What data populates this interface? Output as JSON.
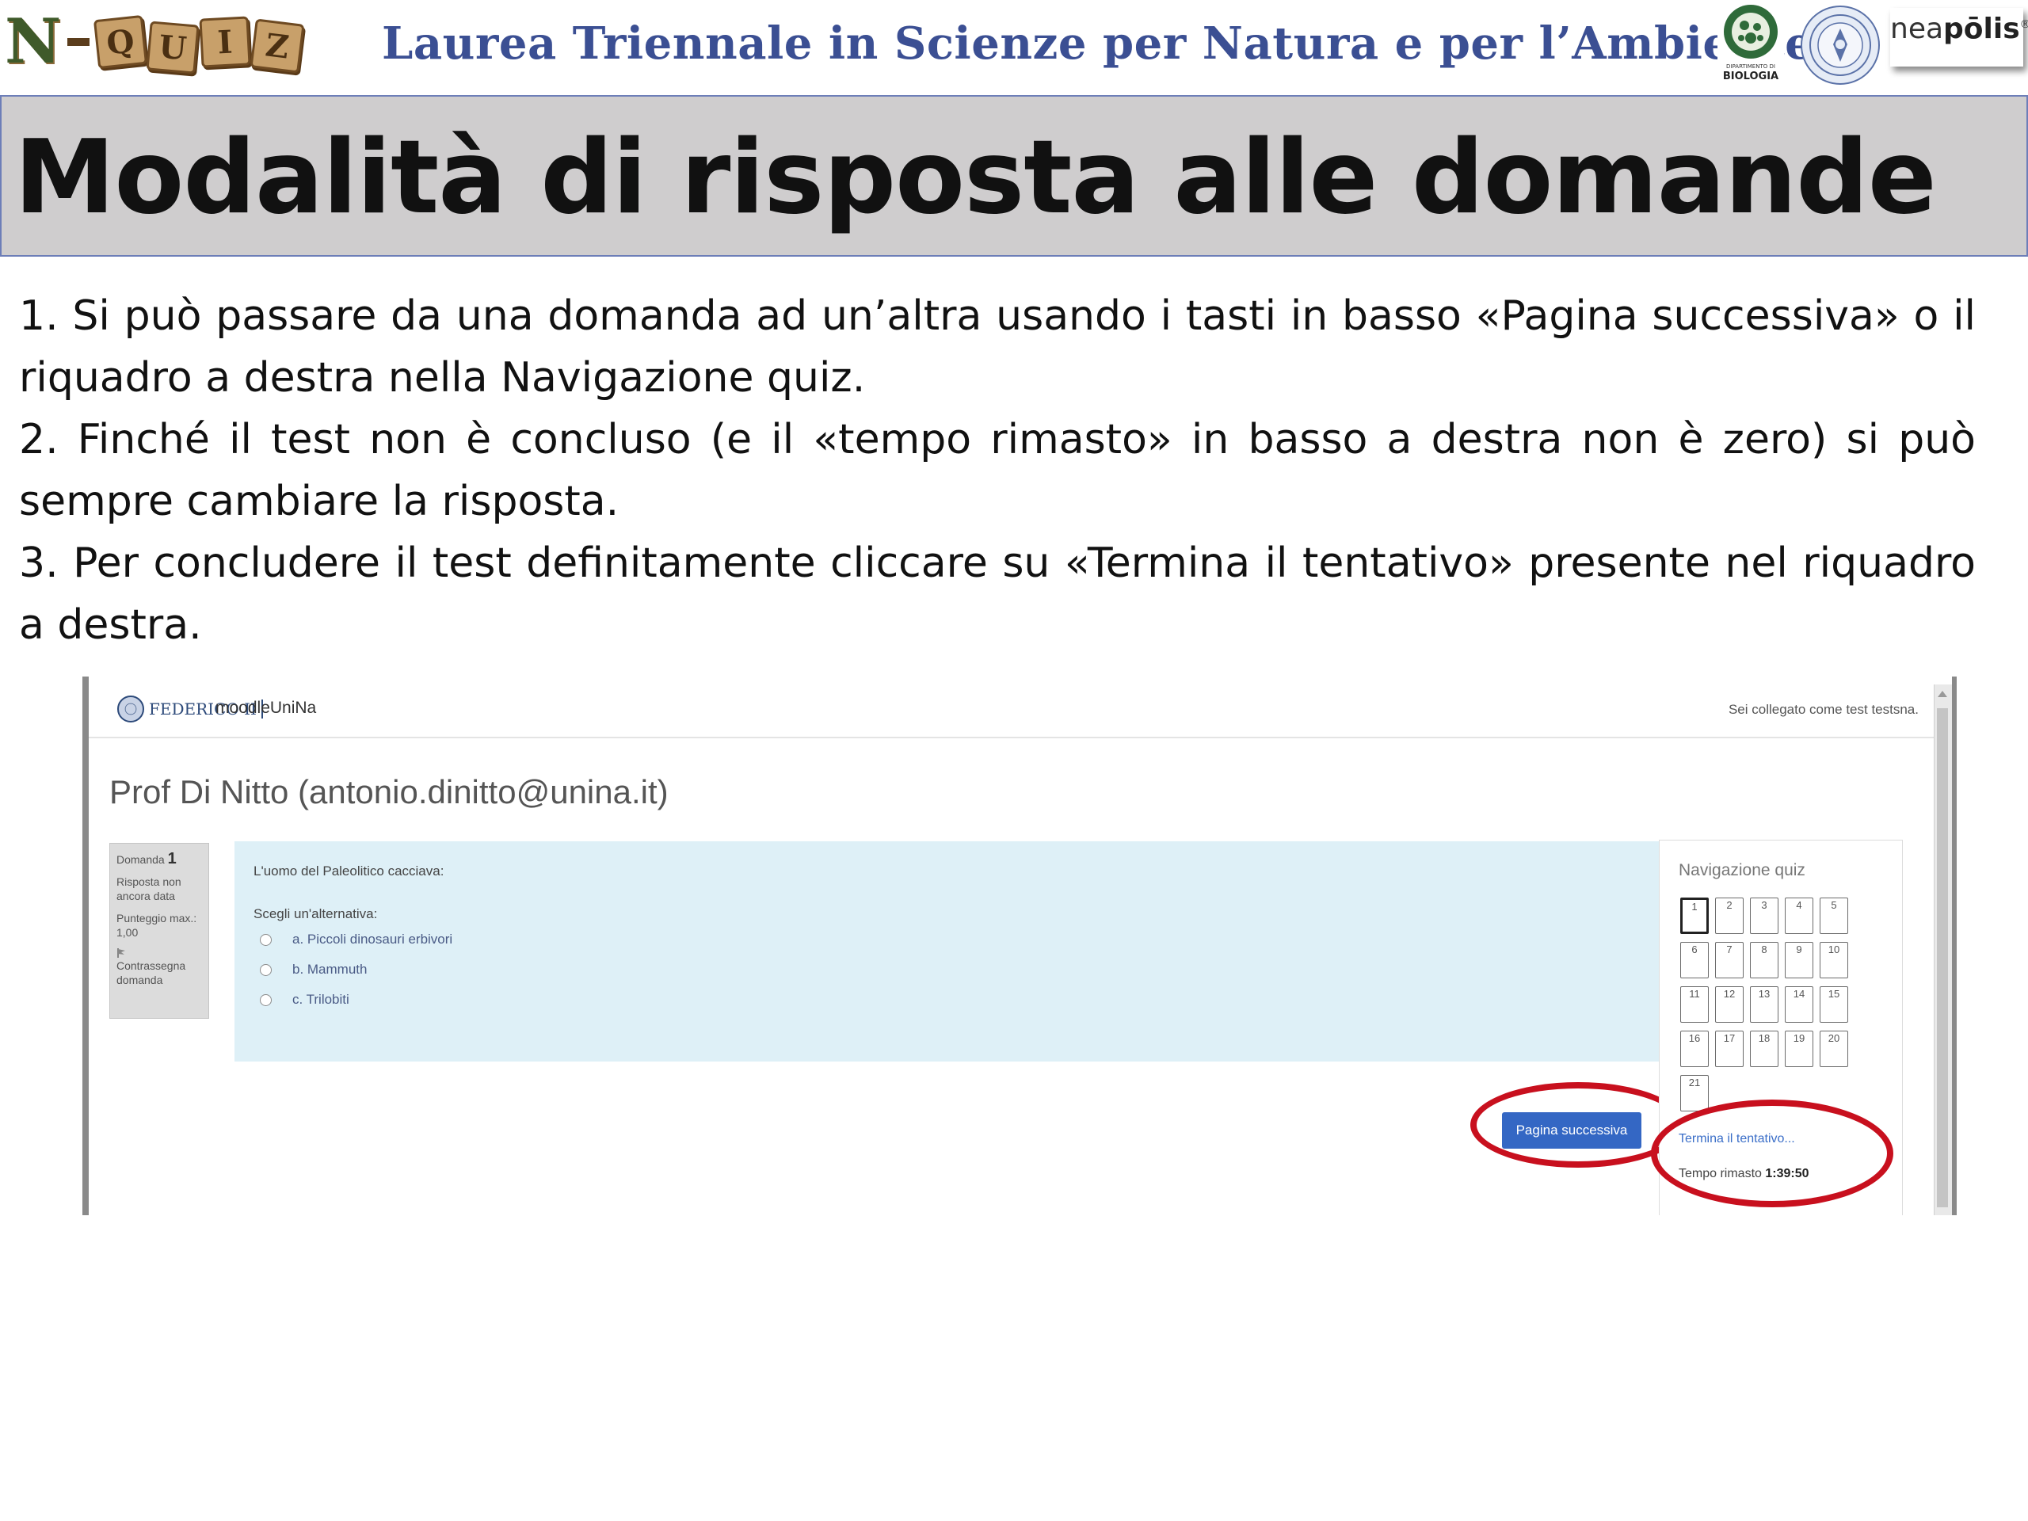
{
  "header": {
    "logo_letter": "N",
    "logo_tiles": [
      "Q",
      "U",
      "I",
      "Z"
    ],
    "course_title": "Laurea Triennale in Scienze per Natura e per l’Ambiente",
    "logos": [
      "dipartimento-biologia-logo",
      "unina-seal-logo",
      "neapolis-logo"
    ],
    "neapolis_prefix": "nea",
    "neapolis_bold": "pōlis",
    "neapolis_mark": "®",
    "biologia_label_1": "DIPARTIMENTO DI",
    "biologia_label_2": "BIOLOGIA"
  },
  "slide": {
    "title": "Modalità di risposta alle domande",
    "points": [
      "1. Si può passare da una domanda ad un’altra usando i tasti in basso «Pagina successiva» o il riquadro a destra nella Navigazione quiz.",
      "2. Finché il test non è concluso (e il «tempo rimasto» in basso a destra non è zero) si può sempre cambiare la risposta.",
      "3. Per concludere il test definitamente cliccare su «Termina il tentativo» presente nel riquadro a destra."
    ]
  },
  "moodle": {
    "fed_text": "FEDERICO II",
    "brand": "moodleUniNa",
    "logged_in_as": "Sei collegato come test testsna.",
    "course_heading": "Prof Di Nitto (antonio.dinitto@unina.it)",
    "question_info": {
      "label": "Domanda",
      "number": "1",
      "status": "Risposta non ancora data",
      "score": "Punteggio max.: 1,00",
      "flag": "Contrassegna domanda"
    },
    "question": {
      "text": "L'uomo del Paleolitico cacciava:",
      "prompt": "Scegli un'alternativa:",
      "options": [
        "a. Piccoli dinosauri erbivori",
        "b. Mammuth",
        "c. Trilobiti"
      ]
    },
    "next_button": "Pagina successiva",
    "nav": {
      "title": "Navigazione quiz",
      "questions": [
        "1",
        "2",
        "3",
        "4",
        "5",
        "6",
        "7",
        "8",
        "9",
        "10",
        "11",
        "12",
        "13",
        "14",
        "15",
        "16",
        "17",
        "18",
        "19",
        "20",
        "21"
      ],
      "current": "1",
      "end_attempt": "Termina il tentativo...",
      "time_label": "Tempo rimasto",
      "time_value": "1:39:50"
    }
  },
  "colors": {
    "course_title": "#3b4f93",
    "title_band": "#cfcdce",
    "highlight_ring": "#c8101e",
    "next_button": "#3467c4",
    "question_box": "#def0f7"
  }
}
